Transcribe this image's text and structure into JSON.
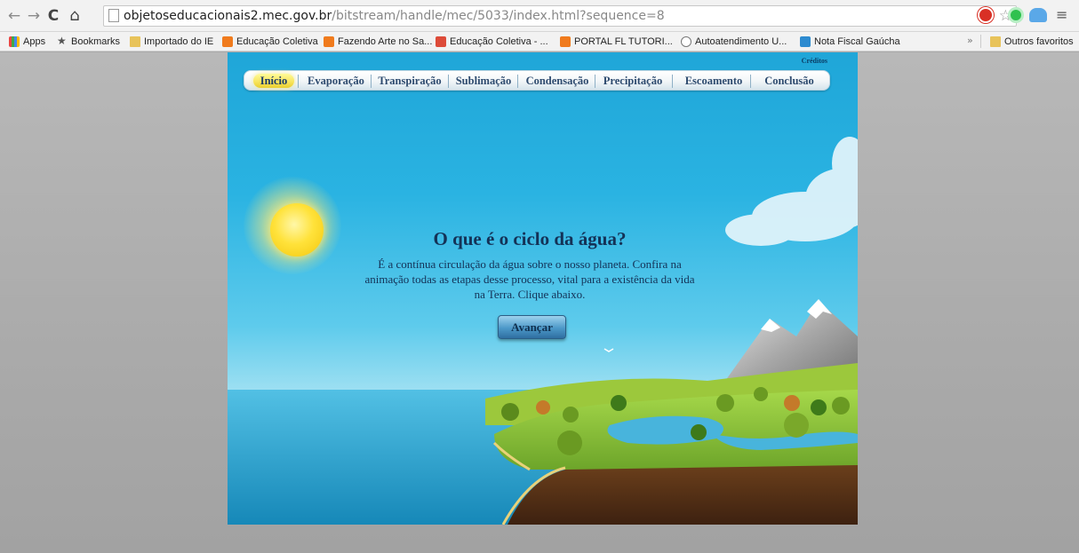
{
  "browser": {
    "url_host": "objetoseducacionais2.mec.gov.br",
    "url_path": "/bitstream/handle/mec/5033/index.html?sequence=8",
    "back_icon": "←",
    "forward_icon": "→",
    "reload_icon": "C",
    "home_icon": "⌂",
    "star_icon": "☆",
    "menu_icon": "≡",
    "overflow_icon": "»"
  },
  "bookmarks": {
    "items": [
      {
        "label": "Apps",
        "icon": "apps-icon"
      },
      {
        "label": "Bookmarks",
        "icon": "star-icon"
      },
      {
        "label": "Importado do IE",
        "icon": "folder-icon"
      },
      {
        "label": "Educação Coletiva",
        "icon": "blogger-icon"
      },
      {
        "label": "Fazendo Arte no Sa...",
        "icon": "blogger-icon"
      },
      {
        "label": "Educação Coletiva - ...",
        "icon": "gplus-icon"
      },
      {
        "label": "PORTAL FL TUTORI...",
        "icon": "blogger-icon"
      },
      {
        "label": "Autoatendimento U...",
        "icon": "gear-icon"
      },
      {
        "label": "Nota Fiscal Gaúcha",
        "icon": "nfg-icon"
      }
    ],
    "other": "Outros favoritos"
  },
  "stage": {
    "credits": "Créditos",
    "menu": [
      "Início",
      "Evaporação",
      "Transpiração",
      "Sublimação",
      "Condensação",
      "Precipitação",
      "Escoamento",
      "Conclusão"
    ],
    "active_tab": "Início",
    "heading": "O que é o ciclo da água?",
    "intro": "É a contínua circulação da água sobre o nosso planeta. Confira na animação todas as etapas desse processo, vital para a existência da vida na Terra. Clique abaixo.",
    "button": "Avançar"
  },
  "colors": {
    "sky": "#2ab3e2",
    "text_dark_blue": "#143257",
    "active_tab_yellow": "#f7e35a",
    "grass": "#8cc63f",
    "soil": "#5a3416"
  }
}
